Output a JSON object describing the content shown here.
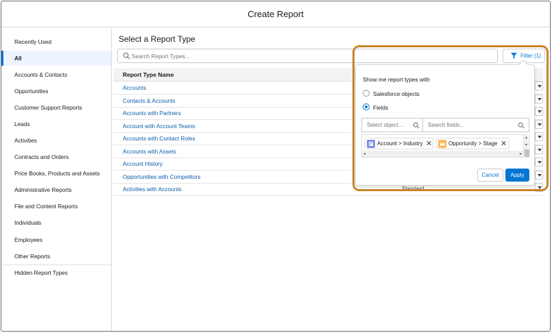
{
  "modal": {
    "title": "Create Report"
  },
  "sidebar": {
    "items": [
      {
        "label": "Recently Used"
      },
      {
        "label": "All",
        "active": true
      },
      {
        "label": "Accounts & Contacts"
      },
      {
        "label": "Opportunities"
      },
      {
        "label": "Customer Support Reports"
      },
      {
        "label": "Leads"
      },
      {
        "label": "Activities"
      },
      {
        "label": "Contracts and Orders"
      },
      {
        "label": "Price Books, Products and Assets"
      },
      {
        "label": "Administrative Reports"
      },
      {
        "label": "File and Content Reports"
      },
      {
        "label": "Individuals"
      },
      {
        "label": "Employees"
      },
      {
        "label": "Other Reports"
      },
      {
        "label": "Hidden Report Types"
      }
    ]
  },
  "main": {
    "title": "Select a Report Type",
    "search": {
      "placeholder": "Search Report Types...",
      "value": ""
    },
    "filter_button": {
      "label": "Filter (1)"
    },
    "table": {
      "header": "Report Type Name",
      "rows": [
        {
          "name": "Accounts",
          "category": ""
        },
        {
          "name": "Contacts & Accounts",
          "category": ""
        },
        {
          "name": "Accounts with Partners",
          "category": ""
        },
        {
          "name": "Account with Account Teams",
          "category": ""
        },
        {
          "name": "Accounts with Contact Roles",
          "category": ""
        },
        {
          "name": "Accounts with Assets",
          "category": ""
        },
        {
          "name": "Account History",
          "category": ""
        },
        {
          "name": "Opportunities with Competitors",
          "category": ""
        },
        {
          "name": "Activities with Accounts",
          "category": "Standard"
        }
      ]
    }
  },
  "filter_popover": {
    "label": "Show me report types with",
    "options": [
      {
        "label": "Salesforce objects",
        "selected": false
      },
      {
        "label": "Fields",
        "selected": true
      }
    ],
    "object_search": {
      "placeholder": "Select object...",
      "value": ""
    },
    "field_search": {
      "placeholder": "Search fields...",
      "value": ""
    },
    "pills": [
      {
        "label": "Account > Industry",
        "color": "#7f8de1"
      },
      {
        "label": "Opportunity > Stage",
        "color": "#fcb95b"
      }
    ],
    "cancel_label": "Cancel",
    "apply_label": "Apply"
  },
  "colors": {
    "brand": "#0176d3",
    "link": "#0b5cab",
    "highlight": "#c8842a"
  }
}
